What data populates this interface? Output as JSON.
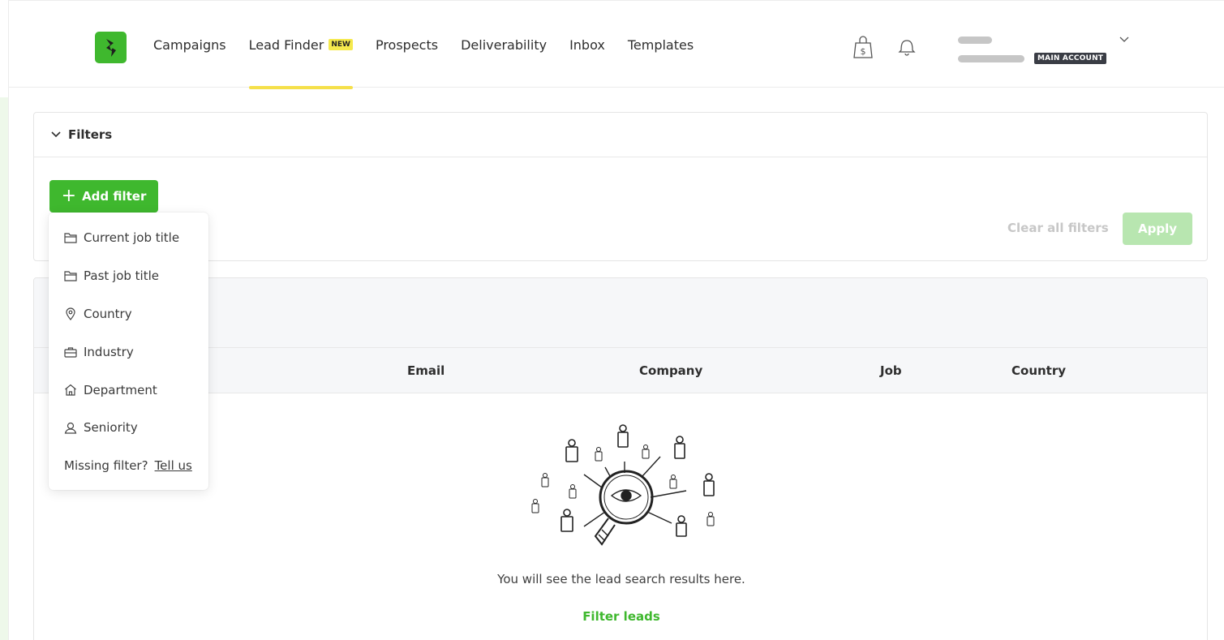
{
  "nav": {
    "items": [
      {
        "label": "Campaigns"
      },
      {
        "label": "Lead Finder",
        "badge": "NEW",
        "active": true
      },
      {
        "label": "Prospects"
      },
      {
        "label": "Deliverability"
      },
      {
        "label": "Inbox"
      },
      {
        "label": "Templates"
      }
    ]
  },
  "header": {
    "icons": [
      "shopping-bag-dollar-icon",
      "bell-icon"
    ],
    "account_badge": "MAIN ACCOUNT"
  },
  "filters": {
    "title": "Filters",
    "add_filter_label": "Add filter",
    "clear_all_label": "Clear all filters",
    "apply_label": "Apply"
  },
  "dropdown": {
    "items": [
      {
        "label": "Current job title",
        "icon": "folder-icon"
      },
      {
        "label": "Past job title",
        "icon": "folder-icon"
      },
      {
        "label": "Country",
        "icon": "location-pin-icon"
      },
      {
        "label": "Industry",
        "icon": "briefcase-icon"
      },
      {
        "label": "Department",
        "icon": "home-icon"
      },
      {
        "label": "Seniority",
        "icon": "user-icon"
      }
    ],
    "missing_text": "Missing filter?",
    "missing_link": "Tell us"
  },
  "table": {
    "columns": [
      "Email",
      "Company",
      "Job",
      "Country"
    ]
  },
  "empty_state": {
    "message": "You will see the lead search results here.",
    "action": "Filter leads"
  },
  "colors": {
    "brand_green": "#3fb82e",
    "active_underline": "#f5e04a",
    "apply_disabled": "#b8e6b0"
  }
}
